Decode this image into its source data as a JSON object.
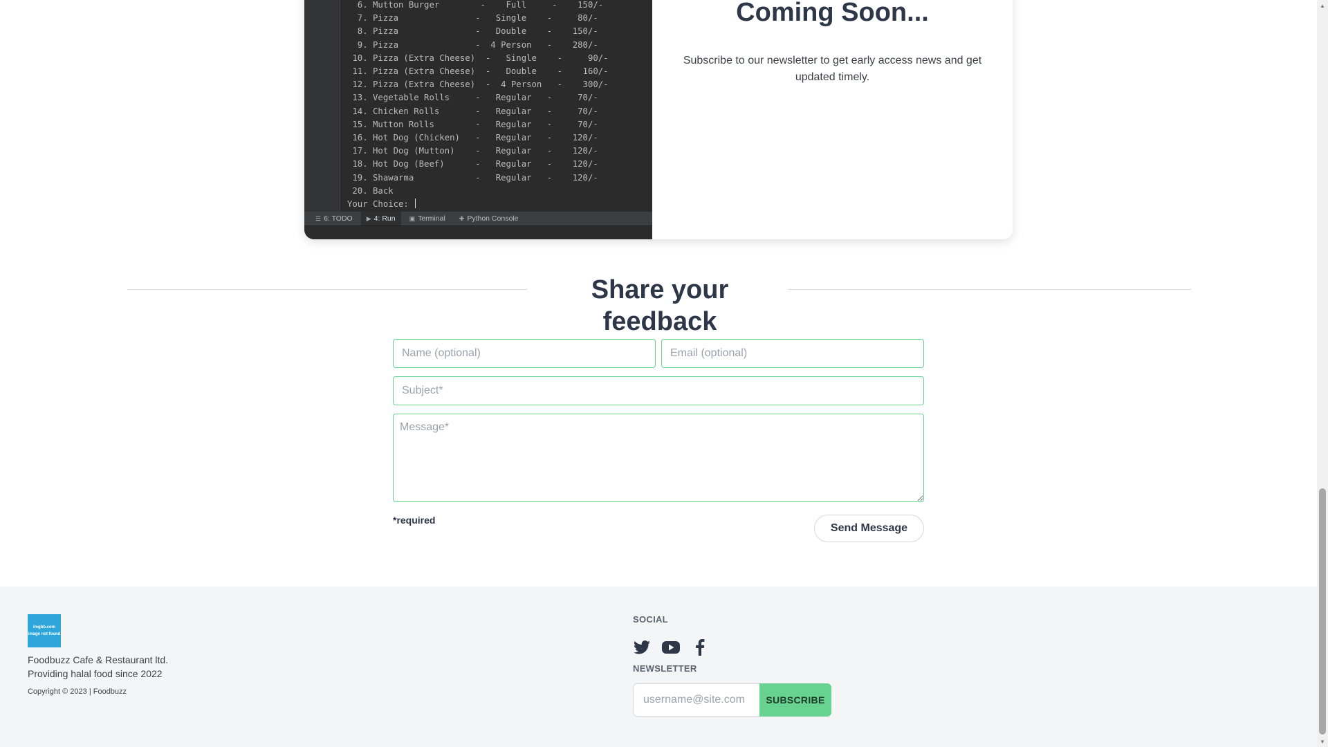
{
  "ide": {
    "code_text": "  6. Mutton Burger        -    Full     -    150/-\n  7. Pizza               -   Single    -     80/-\n  8. Pizza               -   Double    -    150/-\n  9. Pizza               -  4 Person   -    280/-\n 10. Pizza (Extra Cheese)  -   Single    -     90/-\n 11. Pizza (Extra Cheese)  -   Double    -    160/-\n 12. Pizza (Extra Cheese)  -  4 Person   -    300/-\n 13. Vegetable Rolls     -   Regular   -     70/-\n 14. Chicken Rolls       -   Regular   -     70/-\n 15. Mutton Rolls        -   Regular   -     70/-\n 16. Hot Dog (Chicken)   -   Regular   -    120/-\n 17. Hot Dog (Mutton)    -   Regular   -    120/-\n 18. Hot Dog (Beef)      -   Regular   -    120/-\n 19. Shawarma            -   Regular   -    120/-\n 20. Back",
    "prompt": "Your Choice: ",
    "toolbar": [
      {
        "icon": "☰",
        "label": "6: TODO"
      },
      {
        "icon": "▶",
        "label": "4: Run"
      },
      {
        "icon": "▣",
        "label": "Terminal"
      },
      {
        "icon": "✚",
        "label": "Python Console"
      }
    ]
  },
  "coming_soon": {
    "heading": "Coming Soon...",
    "description": "Subscribe to our newsletter to get early access news and get updated timely."
  },
  "feedback": {
    "title": "Share your feedback",
    "name_placeholder": "Name (optional)",
    "email_placeholder": "Email (optional)",
    "subject_placeholder": "Subject*",
    "message_placeholder": "Message*",
    "required_note": "*required",
    "send_label": "Send Message"
  },
  "footer": {
    "logo_line1": "imgbb.com",
    "logo_line2": "image not found",
    "brand_line1": "Foodbuzz Cafe & Restaurant ltd.",
    "brand_line2": "Providing halal food since 2022",
    "copyright": "Copyright © 2023 | Foodbuzz",
    "social_label": "SOCIAL",
    "social_icons": [
      "twitter-icon",
      "youtube-icon",
      "facebook-icon"
    ],
    "newsletter_label": "NEWSLETTER",
    "newsletter_placeholder": "username@site.com",
    "subscribe_label": "SUBSCRIBE"
  },
  "colors": {
    "accent": "#68d391",
    "heading": "#2d3748",
    "logo_bg": "#2ea6dc",
    "footer_bg": "#f4f5f7"
  }
}
